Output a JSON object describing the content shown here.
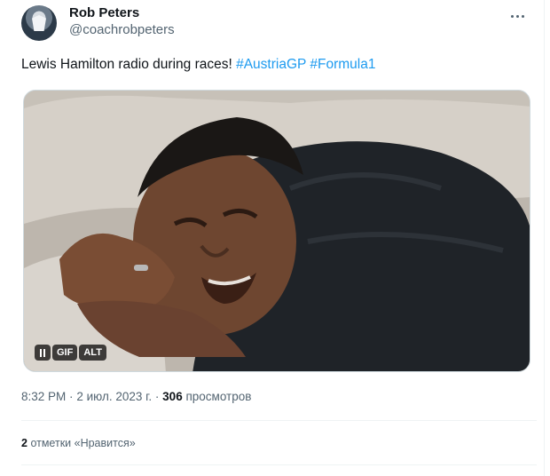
{
  "author": {
    "display_name": "Rob Peters",
    "handle": "@coachrobpeters"
  },
  "tweet": {
    "text_plain": "Lewis Hamilton radio during races!",
    "hashtags": [
      "#AustriaGP",
      "#Formula1"
    ]
  },
  "media": {
    "type": "gif",
    "controls": {
      "gif_label": "GIF",
      "alt_label": "ALT"
    }
  },
  "meta": {
    "time": "8:32 PM",
    "separator": "·",
    "date": "2 июл. 2023 г.",
    "views_count": "306",
    "views_label": "просмотров"
  },
  "likes": {
    "count": "2",
    "label": "отметки «Нравится»"
  },
  "colors": {
    "link": "#1d9bf0",
    "text_primary": "#0f1419",
    "text_secondary": "#536471"
  }
}
